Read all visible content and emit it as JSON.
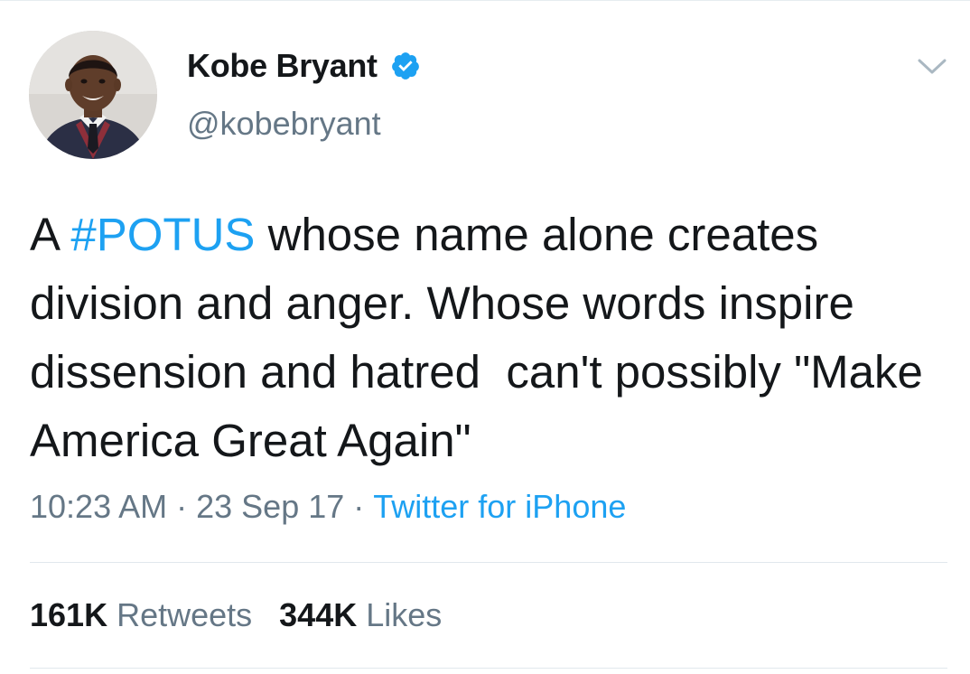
{
  "author": {
    "display_name": "Kobe Bryant",
    "handle": "@kobebryant",
    "verified": true,
    "avatar_icon": "avatar-photo"
  },
  "tweet": {
    "text_prefix": "A ",
    "hashtag": "#POTUS",
    "text_suffix": " whose name alone creates division and anger. Whose words inspire dissension and hatred  can't possibly \"Make America Great Again\""
  },
  "meta": {
    "time": "10:23 AM",
    "separator": "·",
    "date": "23 Sep 17",
    "source": "Twitter for iPhone"
  },
  "stats": {
    "retweets_count": "161K",
    "retweets_label": "Retweets",
    "likes_count": "344K",
    "likes_label": "Likes"
  },
  "colors": {
    "link": "#1da1f2",
    "secondary_text": "#657786",
    "primary_text": "#14171a",
    "divider": "#e1e8ed"
  }
}
